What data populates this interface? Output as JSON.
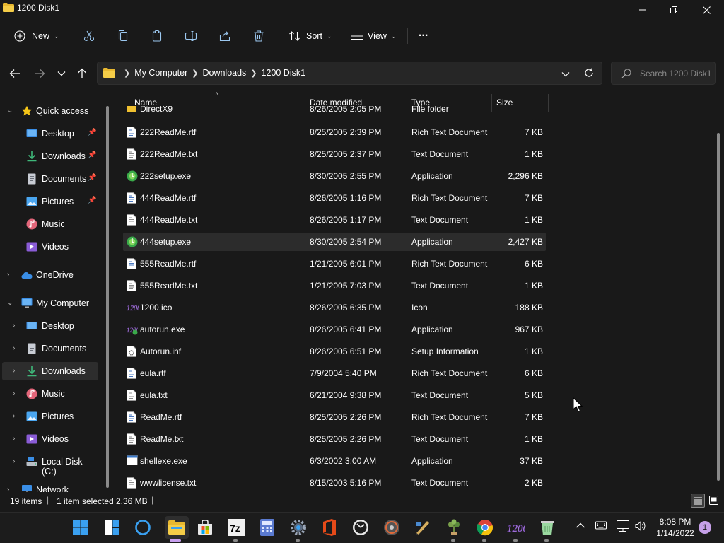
{
  "window": {
    "title": "1200 Disk1"
  },
  "toolbar": {
    "new_label": "New",
    "sort_label": "Sort",
    "view_label": "View",
    "more_label": "..."
  },
  "address": {
    "crumbs": [
      "My Computer",
      "Downloads",
      "1200 Disk1"
    ]
  },
  "search": {
    "placeholder": "Search 1200 Disk1"
  },
  "sidebar": {
    "quick_access": "Quick access",
    "quick_items": [
      "Desktop",
      "Downloads",
      "Documents",
      "Pictures",
      "Music",
      "Videos"
    ],
    "onedrive": "OneDrive",
    "my_computer": "My Computer",
    "computer_items": [
      "Desktop",
      "Documents",
      "Downloads",
      "Music",
      "Pictures",
      "Videos",
      "Local Disk (C:)"
    ],
    "network": "Network"
  },
  "columns": {
    "name": "Name",
    "date": "Date modified",
    "type": "Type",
    "size": "Size"
  },
  "partial_row": {
    "name": "DirectX9",
    "date": "8/26/2005 2:05 PM",
    "type": "File folder"
  },
  "files": [
    {
      "name": "222ReadMe.rtf",
      "date": "8/25/2005 2:39 PM",
      "type": "Rich Text Document",
      "size": "7 KB",
      "icon": "rtf-file-icon"
    },
    {
      "name": "222ReadMe.txt",
      "date": "8/25/2005 2:37 PM",
      "type": "Text Document",
      "size": "1 KB",
      "icon": "text-file-icon"
    },
    {
      "name": "222setup.exe",
      "date": "8/30/2005 2:55 PM",
      "type": "Application",
      "size": "2,296 KB",
      "icon": "setup-exe-icon"
    },
    {
      "name": "444ReadMe.rtf",
      "date": "8/26/2005 1:16 PM",
      "type": "Rich Text Document",
      "size": "7 KB",
      "icon": "rtf-file-icon"
    },
    {
      "name": "444ReadMe.txt",
      "date": "8/26/2005 1:17 PM",
      "type": "Text Document",
      "size": "1 KB",
      "icon": "text-file-icon"
    },
    {
      "name": "444setup.exe",
      "date": "8/30/2005 2:54 PM",
      "type": "Application",
      "size": "2,427 KB",
      "icon": "setup-exe-icon"
    },
    {
      "name": "555ReadMe.rtf",
      "date": "1/21/2005 6:01 PM",
      "type": "Rich Text Document",
      "size": "6 KB",
      "icon": "rtf-file-icon"
    },
    {
      "name": "555ReadMe.txt",
      "date": "1/21/2005 7:03 PM",
      "type": "Text Document",
      "size": "1 KB",
      "icon": "text-file-icon"
    },
    {
      "name": "1200.ico",
      "date": "8/26/2005 6:35 PM",
      "type": "Icon",
      "size": "188 KB",
      "icon": "ico-file-icon"
    },
    {
      "name": "autorun.exe",
      "date": "8/26/2005 6:41 PM",
      "type": "Application",
      "size": "967 KB",
      "icon": "autorun-exe-icon"
    },
    {
      "name": "Autorun.inf",
      "date": "8/26/2005 6:51 PM",
      "type": "Setup Information",
      "size": "1 KB",
      "icon": "inf-file-icon"
    },
    {
      "name": "eula.rtf",
      "date": "7/9/2004 5:40 PM",
      "type": "Rich Text Document",
      "size": "6 KB",
      "icon": "rtf-file-icon"
    },
    {
      "name": "eula.txt",
      "date": "6/21/2004 9:38 PM",
      "type": "Text Document",
      "size": "5 KB",
      "icon": "text-file-icon"
    },
    {
      "name": "ReadMe.rtf",
      "date": "8/25/2005 2:26 PM",
      "type": "Rich Text Document",
      "size": "7 KB",
      "icon": "rtf-file-icon"
    },
    {
      "name": "ReadMe.txt",
      "date": "8/25/2005 2:26 PM",
      "type": "Text Document",
      "size": "1 KB",
      "icon": "text-file-icon"
    },
    {
      "name": "shellexe.exe",
      "date": "6/3/2002 3:00 AM",
      "type": "Application",
      "size": "37 KB",
      "icon": "window-exe-icon"
    },
    {
      "name": "wwwlicense.txt",
      "date": "8/15/2003 5:16 PM",
      "type": "Text Document",
      "size": "2 KB",
      "icon": "text-file-icon"
    }
  ],
  "selected_file": "444setup.exe",
  "status": {
    "items": "19 items",
    "selection": "1 item selected",
    "size": "2.36 MB"
  },
  "taskbar": {
    "apps": [
      "start-icon",
      "task-view-icon",
      "cortana-icon",
      "file-explorer-icon",
      "store-icon",
      "7zip-icon",
      "calculator-icon",
      "settings-icon",
      "office-icon",
      "clock-app-icon",
      "media-player-icon",
      "paint-app-icon",
      "plant-app-icon",
      "chrome-icon",
      "1200-app-icon",
      "recycle-app-icon"
    ],
    "time": "8:08 PM",
    "date": "1/14/2022",
    "notification_count": "1"
  },
  "colors": {
    "accent_blue": "#3a8ee6",
    "folder_yellow": "#f0c030",
    "background": "#191919",
    "selection": "#2c2c2c"
  }
}
